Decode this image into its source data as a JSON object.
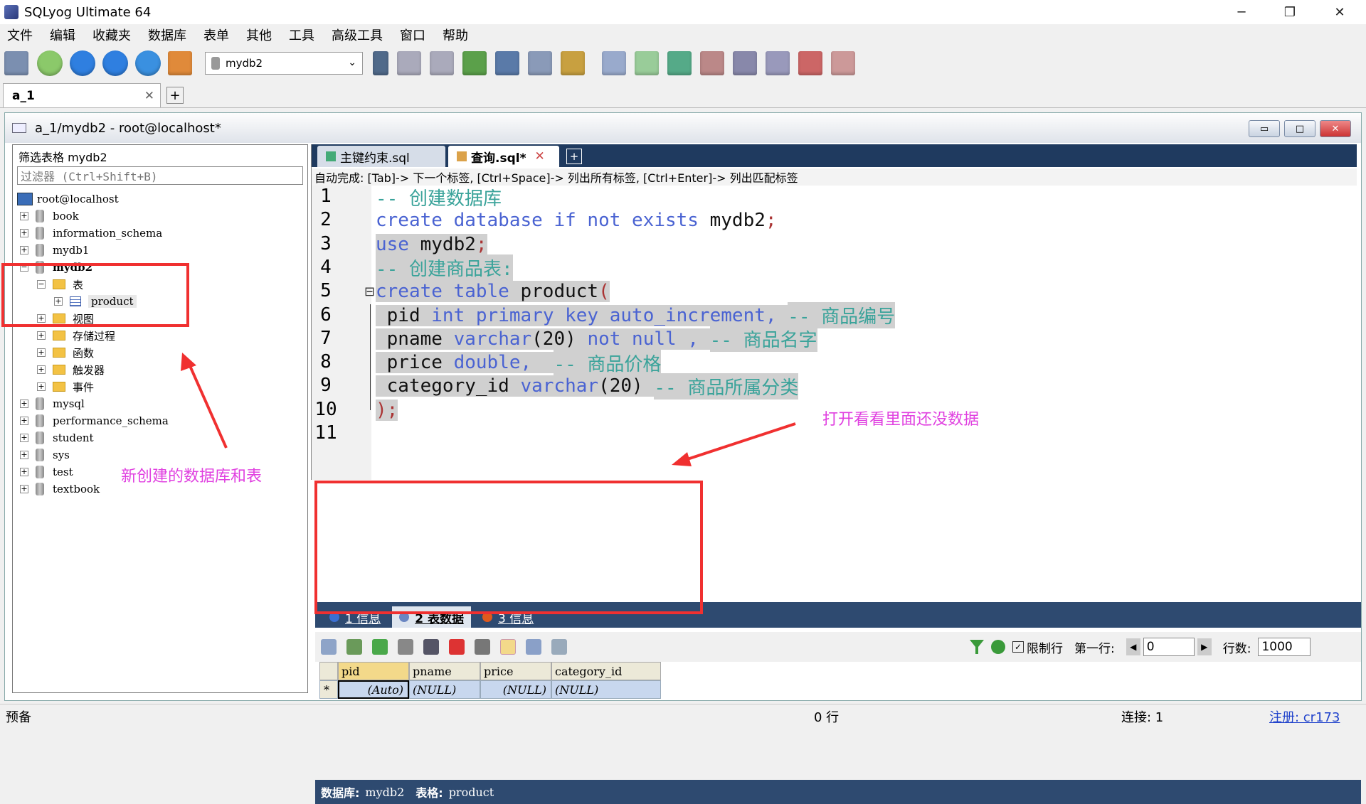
{
  "window": {
    "title": "SQLyog Ultimate 64",
    "minimize": "─",
    "maximize": "❐",
    "close": "✕"
  },
  "menu": [
    "文件",
    "编辑",
    "收藏夹",
    "数据库",
    "表单",
    "其他",
    "工具",
    "高级工具",
    "窗口",
    "帮助"
  ],
  "toolbar": {
    "db_select": "mydb2",
    "db_select_arrow": "⌄"
  },
  "conn_tab": {
    "label": "a_1",
    "close": "✕",
    "add": "+"
  },
  "conn_window": {
    "title": "a_1/mydb2 - root@localhost*",
    "btn_min": "▭",
    "btn_max": "□",
    "btn_close": "✕"
  },
  "object_browser": {
    "filter_label": "筛选表格 mydb2",
    "filter_placeholder": "过滤器 (Ctrl+Shift+B)",
    "root": "root@localhost",
    "items": [
      {
        "label": "book",
        "kind": "db",
        "expand": "+"
      },
      {
        "label": "information_schema",
        "kind": "db",
        "expand": "+"
      },
      {
        "label": "mydb1",
        "kind": "db",
        "expand": "+"
      },
      {
        "label": "mydb2",
        "kind": "db",
        "expand": "−"
      },
      {
        "label": "表",
        "kind": "folder",
        "expand": "−"
      },
      {
        "label": "product",
        "kind": "table",
        "expand": "+"
      },
      {
        "label": "视图",
        "kind": "folder",
        "expand": "+"
      },
      {
        "label": "存储过程",
        "kind": "folder",
        "expand": "+"
      },
      {
        "label": "函数",
        "kind": "folder",
        "expand": "+"
      },
      {
        "label": "触发器",
        "kind": "folder",
        "expand": "+"
      },
      {
        "label": "事件",
        "kind": "folder",
        "expand": "+"
      },
      {
        "label": "mysql",
        "kind": "db",
        "expand": "+"
      },
      {
        "label": "performance_schema",
        "kind": "db",
        "expand": "+"
      },
      {
        "label": "student",
        "kind": "db",
        "expand": "+"
      },
      {
        "label": "sys",
        "kind": "db",
        "expand": "+"
      },
      {
        "label": "test",
        "kind": "db",
        "expand": "+"
      },
      {
        "label": "textbook",
        "kind": "db",
        "expand": "+"
      }
    ]
  },
  "editor": {
    "tabs": [
      {
        "label": "主键约束.sql",
        "close": ""
      },
      {
        "label": "查询.sql*",
        "close": "✕"
      }
    ],
    "tab_add": "+",
    "autocomplete_hint": "自动完成: [Tab]-> 下一个标签, [Ctrl+Space]-> 列出所有标签, [Ctrl+Enter]-> 列出匹配标签",
    "line_numbers": [
      "1",
      "2",
      "3",
      "4",
      "5",
      "6",
      "7",
      "8",
      "9",
      "10",
      "11"
    ],
    "fold_marker": "⊟",
    "lines": [
      [
        {
          "t": "-- 创建数据库",
          "c": "cm"
        }
      ],
      [
        {
          "t": "create database if not exists ",
          "c": "kw"
        },
        {
          "t": "mydb2",
          "c": "pl"
        },
        {
          "t": ";",
          "c": "pn"
        }
      ],
      [
        {
          "t": "use ",
          "c": "kw"
        },
        {
          "t": "mydb2",
          "c": "pl"
        },
        {
          "t": ";",
          "c": "pn"
        }
      ],
      [
        {
          "t": "-- 创建商品表:",
          "c": "cm"
        }
      ],
      [
        {
          "t": "create table ",
          "c": "kw"
        },
        {
          "t": "product",
          "c": "pl"
        },
        {
          "t": "(",
          "c": "pn"
        }
      ],
      [
        {
          "t": " pid ",
          "c": "pl"
        },
        {
          "t": "int primary key auto_increment, ",
          "c": "kw"
        },
        {
          "t": "-- 商品编号",
          "c": "cm"
        }
      ],
      [
        {
          "t": " pname ",
          "c": "pl"
        },
        {
          "t": "varchar",
          "c": "kw"
        },
        {
          "t": "(20) ",
          "c": "pl"
        },
        {
          "t": "not null , ",
          "c": "kw"
        },
        {
          "t": "-- 商品名字",
          "c": "cm"
        }
      ],
      [
        {
          "t": " price ",
          "c": "pl"
        },
        {
          "t": "double,  ",
          "c": "kw"
        },
        {
          "t": "-- 商品价格",
          "c": "cm"
        }
      ],
      [
        {
          "t": " category_id ",
          "c": "pl"
        },
        {
          "t": "varchar",
          "c": "kw"
        },
        {
          "t": "(20) ",
          "c": "pl"
        },
        {
          "t": "-- 商品所属分类",
          "c": "cm"
        }
      ],
      [
        {
          "t": ");",
          "c": "pn"
        }
      ],
      []
    ]
  },
  "results": {
    "tabs": [
      {
        "label": "1 信息",
        "color": "#3b6fd1"
      },
      {
        "label": "2 表数据",
        "color": "#6a86c2"
      },
      {
        "label": "3 信息",
        "color": "#e05a1e"
      }
    ],
    "limit_rows_label": "限制行",
    "first_row_label": "第一行:",
    "first_row_value": "0",
    "row_count_label": "行数:",
    "row_count_value": "1000",
    "columns": [
      "pid",
      "pname",
      "price",
      "category_id"
    ],
    "row": [
      "(Auto)",
      "(NULL)",
      "(NULL)",
      "(NULL)"
    ],
    "row_marker": "*",
    "status_db_label": "数据库:",
    "status_db": "mydb2",
    "status_table_label": "表格:",
    "status_table": "product"
  },
  "statusbar": {
    "left": "预备",
    "center": "0 行",
    "conn": "连接: 1",
    "reg": "注册: cr173"
  },
  "annotations": {
    "left": "新创建的数据库和表",
    "right": "打开看看里面还没数据"
  },
  "colors": {
    "annotation_red": "#f03030",
    "annotation_pink": "#e040e0",
    "editor_tab_strip": "#1f3a5f",
    "results_strip": "#2e4a70"
  }
}
